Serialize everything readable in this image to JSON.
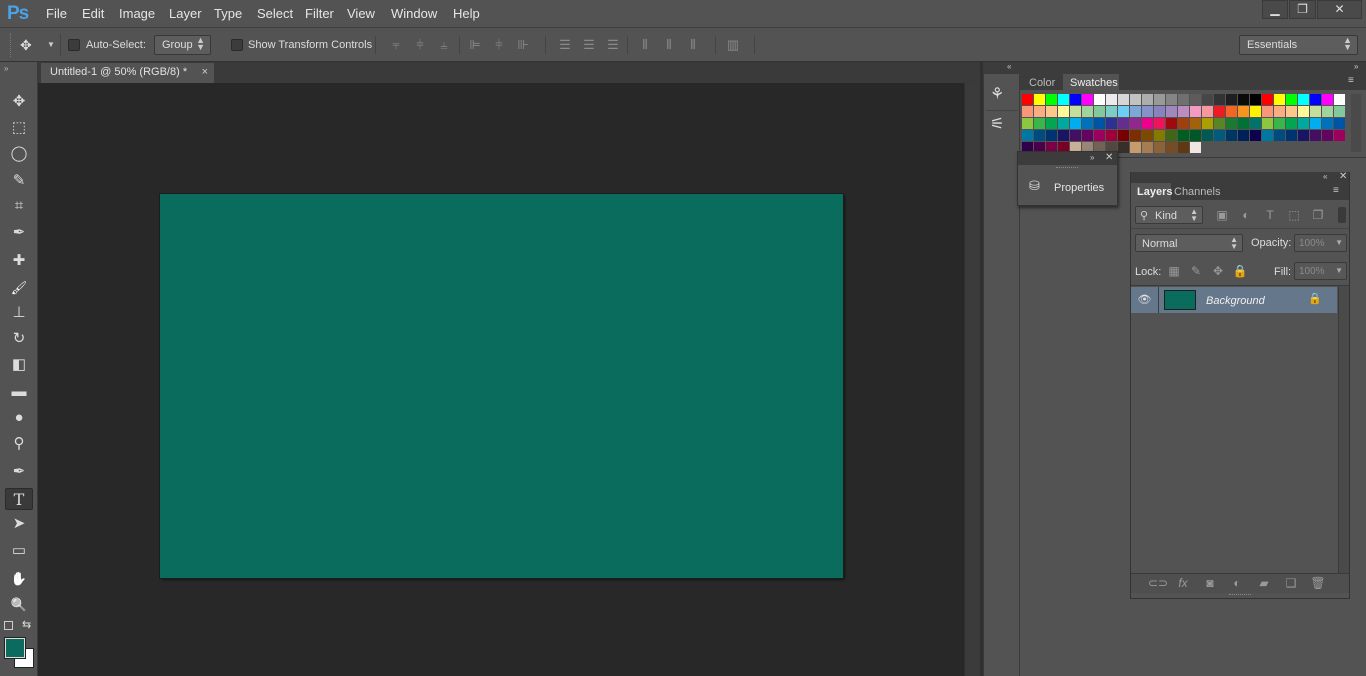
{
  "app": {
    "logo": "Ps",
    "colors": {
      "chrome": "#535353",
      "canvas": "#096c5d",
      "foreground": "#0a6b5e",
      "background": "#ffffff",
      "selection": "#65778a"
    }
  },
  "menu": [
    "File",
    "Edit",
    "Image",
    "Layer",
    "Type",
    "Select",
    "Filter",
    "View",
    "Window",
    "Help"
  ],
  "window_controls": {
    "minimize": "▁",
    "restore": "❐",
    "close": "✕"
  },
  "options_bar": {
    "auto_select_label": "Auto-Select:",
    "auto_select_checked": false,
    "auto_select_target": "Group",
    "show_transform_label": "Show Transform Controls",
    "show_transform_checked": false,
    "workspace": "Essentials"
  },
  "tools": [
    {
      "name": "move-tool",
      "icon": "✥"
    },
    {
      "name": "rectangular-marquee-tool",
      "icon": "⬚"
    },
    {
      "name": "lasso-tool",
      "icon": "◯"
    },
    {
      "name": "quick-selection-tool",
      "icon": "✎"
    },
    {
      "name": "crop-tool",
      "icon": "⌗"
    },
    {
      "name": "eyedropper-tool",
      "icon": "✒"
    },
    {
      "name": "spot-healing-brush-tool",
      "icon": "✚"
    },
    {
      "name": "brush-tool",
      "icon": "🖌"
    },
    {
      "name": "clone-stamp-tool",
      "icon": "⊥"
    },
    {
      "name": "history-brush-tool",
      "icon": "↻"
    },
    {
      "name": "eraser-tool",
      "icon": "◧"
    },
    {
      "name": "gradient-tool",
      "icon": "▬"
    },
    {
      "name": "blur-tool",
      "icon": "●"
    },
    {
      "name": "dodge-tool",
      "icon": "⚲"
    },
    {
      "name": "pen-tool",
      "icon": "✒"
    },
    {
      "name": "type-tool",
      "icon": "T"
    },
    {
      "name": "path-selection-tool",
      "icon": "➤"
    },
    {
      "name": "rectangle-tool",
      "icon": "▭"
    },
    {
      "name": "hand-tool",
      "icon": "✋"
    },
    {
      "name": "zoom-tool",
      "icon": "🔍"
    }
  ],
  "document": {
    "tab_title": "Untitled-1 @ 50% (RGB/8) *",
    "close": "×"
  },
  "color_panel": {
    "tabs": [
      "Color",
      "Swatches"
    ],
    "active": "Swatches"
  },
  "swatch_rows": [
    [
      "#ff0000",
      "#ffff00",
      "#00ff00",
      "#00ffff",
      "#0000ff",
      "#ff00ff",
      "#ffffff",
      "#ebebeb",
      "#d6d6d6",
      "#c2c2c2",
      "#adadad",
      "#999999",
      "#858585",
      "#707070",
      "#5c5c5c",
      "#474747",
      "#333333",
      "#1f1f1f",
      "#0a0a0a",
      "#000000"
    ],
    [
      "#f7977a",
      "#f9ad81",
      "#fdc68a",
      "#fff79a",
      "#c4df9b",
      "#a3d39c",
      "#82ca9d",
      "#7bcdc8",
      "#6ecff6",
      "#7ea7d8",
      "#8493ca",
      "#8882be",
      "#a187be",
      "#bc8dbf",
      "#f49ac2",
      "#f6989d",
      "#ed1c24",
      "#f26522",
      "#f7941d",
      "#fff200"
    ],
    [
      "#8dc63f",
      "#39b54a",
      "#00a651",
      "#00a99d",
      "#00aeef",
      "#0072bc",
      "#0054a6",
      "#2e3192",
      "#662d91",
      "#92278f",
      "#ec008c",
      "#ed145b",
      "#9e0b0f",
      "#a0410d",
      "#a36209",
      "#aba000",
      "#598527",
      "#1a7b30",
      "#007236",
      "#00746b"
    ],
    [
      "#0076a3",
      "#004b80",
      "#003471",
      "#1b1464",
      "#440e62",
      "#630460",
      "#9e005d",
      "#9e0039",
      "#790000",
      "#7b2e00",
      "#7d4900",
      "#827b00",
      "#406618",
      "#005e20",
      "#005826",
      "#005952",
      "#005b7f",
      "#003663",
      "#002157",
      "#0d004c"
    ],
    [
      "#32004b",
      "#4b0049",
      "#7b0046",
      "#7a0026",
      "#c7b299",
      "#998675",
      "#736357",
      "#534741",
      "#37302a",
      "#c69c6d",
      "#a67c52",
      "#8c6239",
      "#754c24",
      "#603913",
      "#f2e6e1"
    ]
  ],
  "properties_panel": {
    "title": "Properties"
  },
  "layers_panel": {
    "tabs": [
      "Layers",
      "Channels"
    ],
    "active": "Layers",
    "filter_kind": "Kind",
    "blend_mode": "Normal",
    "opacity_label": "Opacity:",
    "opacity_value": "100%",
    "lock_label": "Lock:",
    "fill_label": "Fill:",
    "fill_value": "100%",
    "layers": [
      {
        "name": "Background",
        "visible": true,
        "locked": true,
        "thumb": "#096c5d"
      }
    ]
  }
}
